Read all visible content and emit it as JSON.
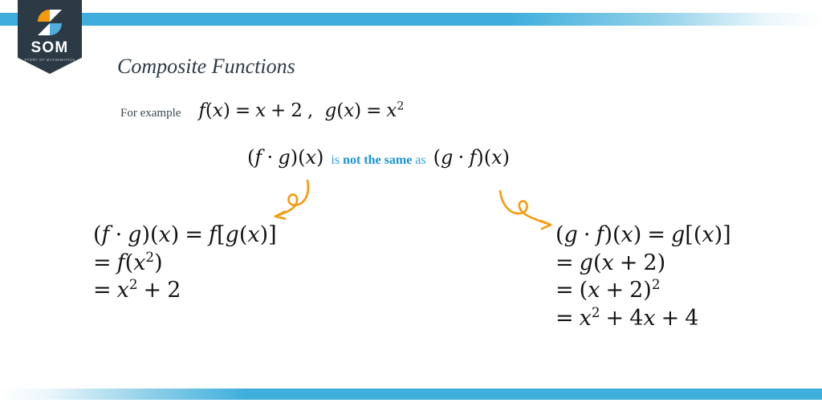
{
  "colors": {
    "accent_blue": "#3FAEDC",
    "text_blue": "#2f9fd6",
    "bold_blue": "#1b93d6",
    "logo_navy": "#2b3a45",
    "logo_orange": "#F59A0B",
    "logo_blue": "#4FAEDC",
    "arrow_orange": "#F59A0B",
    "title_color": "#2d3b46",
    "math_color": "#141414"
  },
  "logo": {
    "name": "SOM",
    "tagline": "STORY OF MATHEMATICS",
    "mark_icon": "som-lightning-mark"
  },
  "slide": {
    "title": "Composite Functions"
  },
  "example": {
    "label": "For example",
    "f_def": "f(x) = x + 2",
    "g_def": "g(x) = x²",
    "full": "f(x) = x + 2 ,  g(x) = x²"
  },
  "comparison": {
    "left_expr": "(f · g)(x)",
    "words_prefix": "is",
    "words_emphasis": "not the same",
    "words_suffix": "as",
    "right_expr": "(g · f)(x)"
  },
  "arrows": {
    "left": {
      "icon": "curly-arrow-down-left",
      "direction": "down-left",
      "color": "#F59A0B"
    },
    "right": {
      "icon": "curly-arrow-down-right",
      "direction": "down-right",
      "color": "#F59A0B"
    }
  },
  "derivation_left": {
    "lines": [
      "(f · g)(x) = f[g(x)]",
      "= f(x²)",
      "= x² + 2"
    ]
  },
  "derivation_right": {
    "lines": [
      "(g · f)(x) = g[(x)]",
      "= g(x + 2)",
      "= (x + 2)²",
      "= x² + 4x + 4"
    ]
  }
}
